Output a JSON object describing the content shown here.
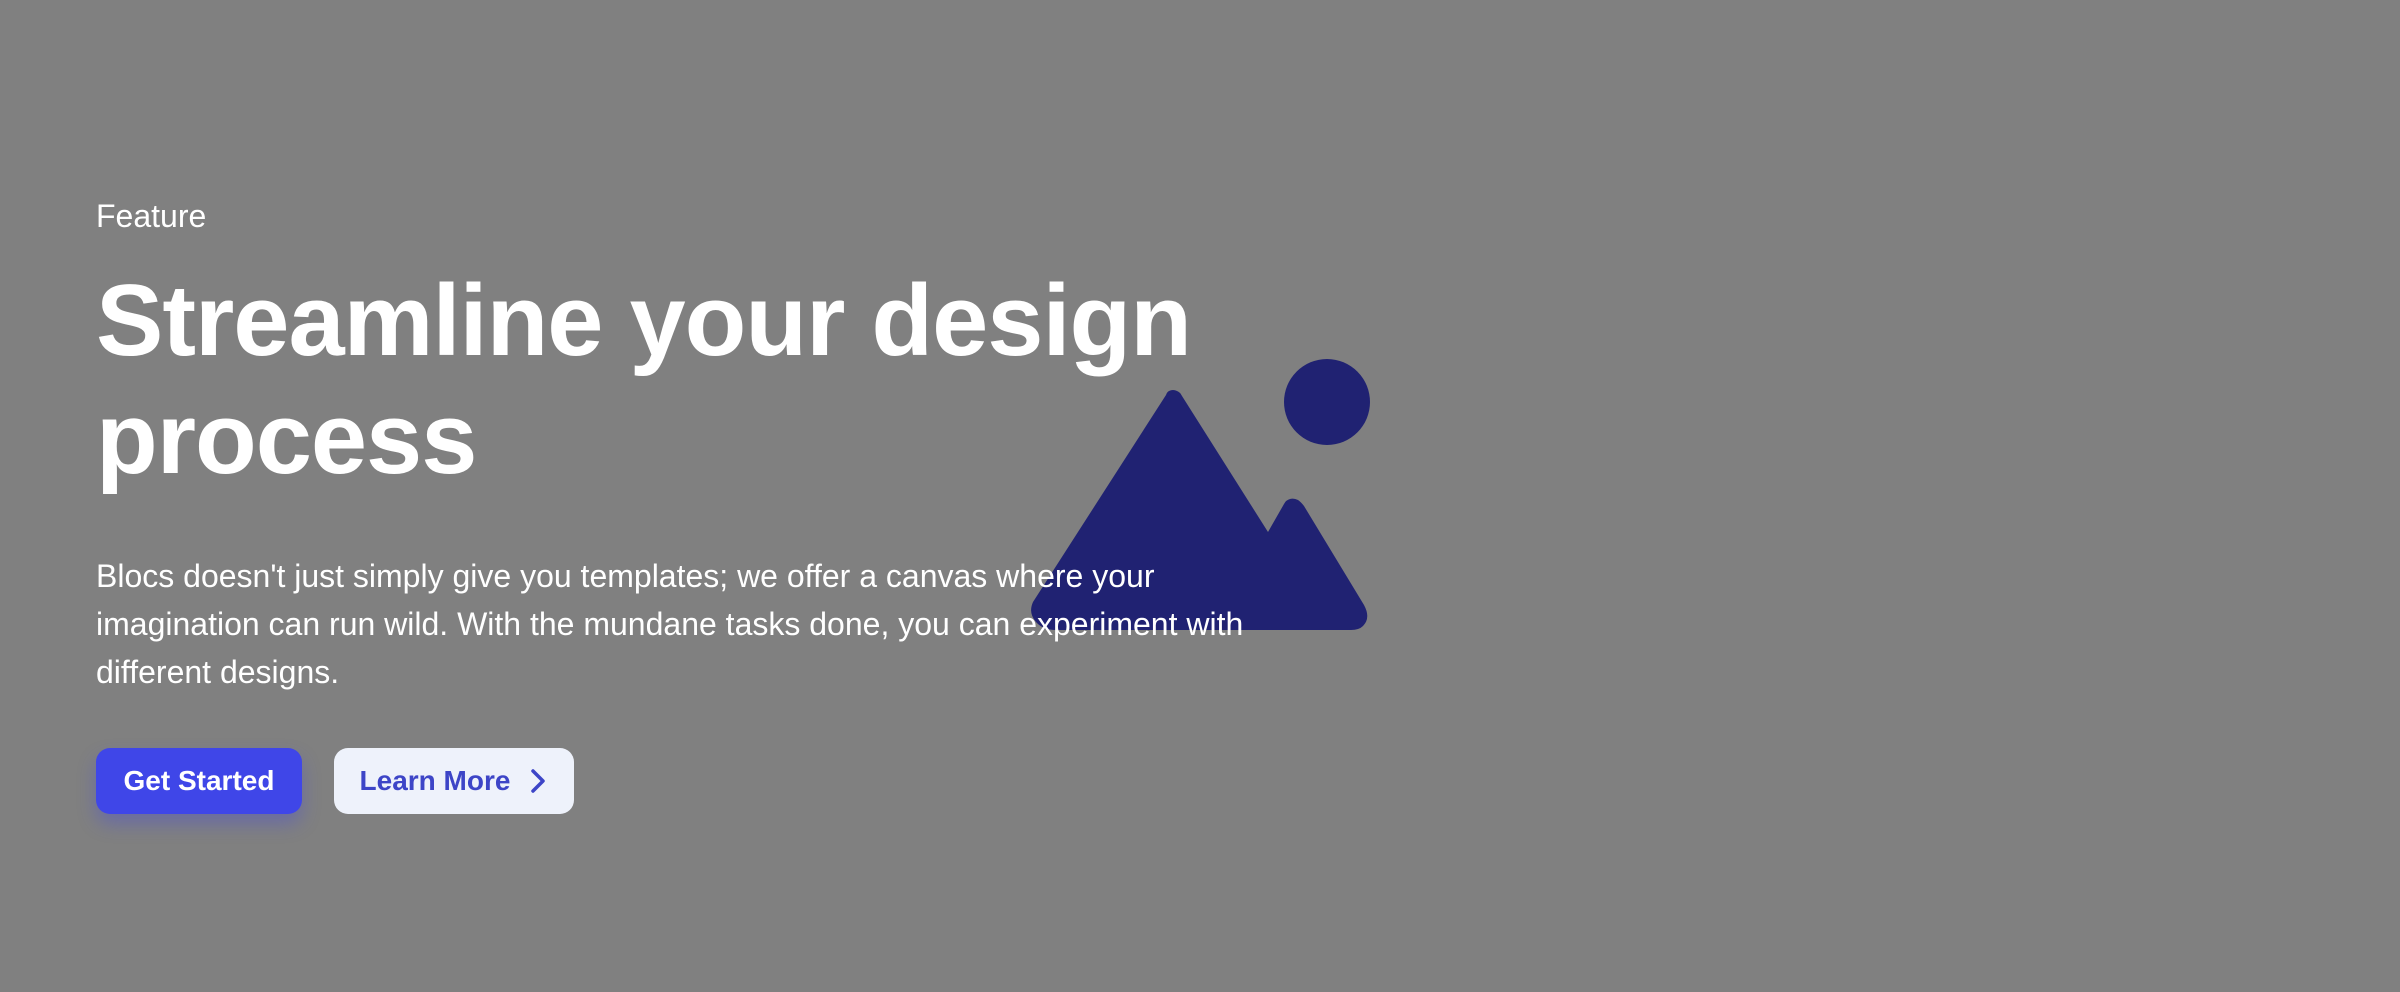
{
  "hero": {
    "eyebrow": "Feature",
    "title_line_1": "Streamline your design",
    "title_line_2": "process",
    "description": "Blocs doesn't just simply give you templates; we offer a canvas where your imagination can run wild. With the mundane tasks done, you can experiment with different designs.",
    "primary_button": "Get Started",
    "secondary_button": "Learn More",
    "image_icon": "image-placeholder-icon",
    "secondary_icon": "chevron-right-icon"
  },
  "colors": {
    "background": "#808080",
    "accent": "#3f46e8",
    "illustration": "#202272",
    "secondary_button_bg": "#eef2fb"
  }
}
